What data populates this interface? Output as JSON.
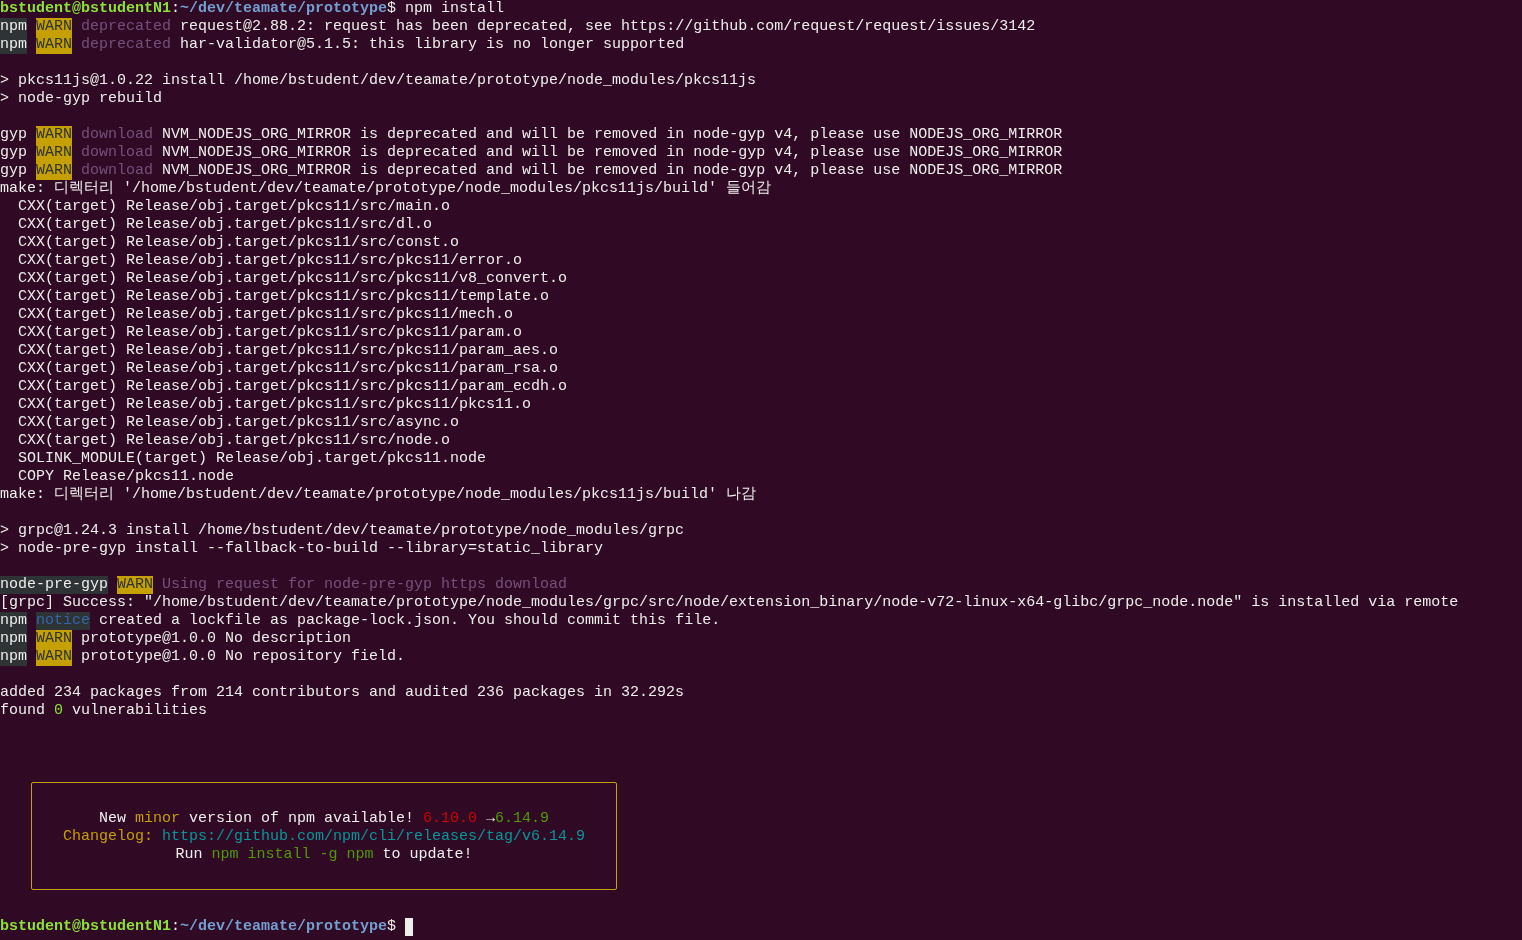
{
  "terminal": {
    "lines": [
      {
        "kind": "output",
        "segs": [
          {
            "kind": "user",
            "text": "bstudent@bstudentN1"
          },
          {
            "kind": "text",
            "text": ":"
          },
          {
            "kind": "path",
            "text": "~/dev/teamate/prototype"
          },
          {
            "kind": "text",
            "text": "$ npm install"
          }
        ]
      },
      {
        "kind": "output",
        "segs": [
          {
            "kind": "label",
            "text": "npm"
          },
          {
            "kind": "warn",
            "text": "WARN"
          },
          {
            "kind": "dim",
            "text": "deprecated"
          },
          {
            "kind": "text",
            "text": " request@2.88.2: request has been deprecated, see https://github.com/request/request/issues/3142"
          }
        ]
      },
      {
        "kind": "output",
        "segs": [
          {
            "kind": "label",
            "text": "npm"
          },
          {
            "kind": "warn",
            "text": "WARN"
          },
          {
            "kind": "dim",
            "text": "deprecated"
          },
          {
            "kind": "text",
            "text": " har-validator@5.1.5: this library is no longer supported"
          }
        ]
      },
      {
        "kind": "blank"
      },
      {
        "kind": "output",
        "segs": [
          {
            "kind": "text",
            "text": "> pkcs11js@1.0.22 install /home/bstudent/dev/teamate/prototype/node_modules/pkcs11js"
          }
        ]
      },
      {
        "kind": "output",
        "segs": [
          {
            "kind": "text",
            "text": "> node-gyp rebuild"
          }
        ]
      },
      {
        "kind": "blank"
      },
      {
        "kind": "output",
        "segs": [
          {
            "kind": "prefix",
            "text": "gyp"
          },
          {
            "kind": "warn",
            "text": "WARN"
          },
          {
            "kind": "dim",
            "text": "download"
          },
          {
            "kind": "text",
            "text": " NVM_NODEJS_ORG_MIRROR is deprecated and will be removed in node-gyp v4, please use NODEJS_ORG_MIRROR"
          }
        ]
      },
      {
        "kind": "output",
        "segs": [
          {
            "kind": "prefix",
            "text": "gyp"
          },
          {
            "kind": "warn",
            "text": "WARN"
          },
          {
            "kind": "dim",
            "text": "download"
          },
          {
            "kind": "text",
            "text": " NVM_NODEJS_ORG_MIRROR is deprecated and will be removed in node-gyp v4, please use NODEJS_ORG_MIRROR"
          }
        ]
      },
      {
        "kind": "output",
        "segs": [
          {
            "kind": "prefix",
            "text": "gyp"
          },
          {
            "kind": "warn",
            "text": "WARN"
          },
          {
            "kind": "dim",
            "text": "download"
          },
          {
            "kind": "text",
            "text": " NVM_NODEJS_ORG_MIRROR is deprecated and will be removed in node-gyp v4, please use NODEJS_ORG_MIRROR"
          }
        ]
      },
      {
        "kind": "output",
        "segs": [
          {
            "kind": "text",
            "text": "make: 디렉터리 '/home/bstudent/dev/teamate/prototype/node_modules/pkcs11js/build' 들어감"
          }
        ]
      },
      {
        "kind": "output",
        "segs": [
          {
            "kind": "text",
            "text": "  CXX(target) Release/obj.target/pkcs11/src/main.o"
          }
        ]
      },
      {
        "kind": "output",
        "segs": [
          {
            "kind": "text",
            "text": "  CXX(target) Release/obj.target/pkcs11/src/dl.o"
          }
        ]
      },
      {
        "kind": "output",
        "segs": [
          {
            "kind": "text",
            "text": "  CXX(target) Release/obj.target/pkcs11/src/const.o"
          }
        ]
      },
      {
        "kind": "output",
        "segs": [
          {
            "kind": "text",
            "text": "  CXX(target) Release/obj.target/pkcs11/src/pkcs11/error.o"
          }
        ]
      },
      {
        "kind": "output",
        "segs": [
          {
            "kind": "text",
            "text": "  CXX(target) Release/obj.target/pkcs11/src/pkcs11/v8_convert.o"
          }
        ]
      },
      {
        "kind": "output",
        "segs": [
          {
            "kind": "text",
            "text": "  CXX(target) Release/obj.target/pkcs11/src/pkcs11/template.o"
          }
        ]
      },
      {
        "kind": "output",
        "segs": [
          {
            "kind": "text",
            "text": "  CXX(target) Release/obj.target/pkcs11/src/pkcs11/mech.o"
          }
        ]
      },
      {
        "kind": "output",
        "segs": [
          {
            "kind": "text",
            "text": "  CXX(target) Release/obj.target/pkcs11/src/pkcs11/param.o"
          }
        ]
      },
      {
        "kind": "output",
        "segs": [
          {
            "kind": "text",
            "text": "  CXX(target) Release/obj.target/pkcs11/src/pkcs11/param_aes.o"
          }
        ]
      },
      {
        "kind": "output",
        "segs": [
          {
            "kind": "text",
            "text": "  CXX(target) Release/obj.target/pkcs11/src/pkcs11/param_rsa.o"
          }
        ]
      },
      {
        "kind": "output",
        "segs": [
          {
            "kind": "text",
            "text": "  CXX(target) Release/obj.target/pkcs11/src/pkcs11/param_ecdh.o"
          }
        ]
      },
      {
        "kind": "output",
        "segs": [
          {
            "kind": "text",
            "text": "  CXX(target) Release/obj.target/pkcs11/src/pkcs11/pkcs11.o"
          }
        ]
      },
      {
        "kind": "output",
        "segs": [
          {
            "kind": "text",
            "text": "  CXX(target) Release/obj.target/pkcs11/src/async.o"
          }
        ]
      },
      {
        "kind": "output",
        "segs": [
          {
            "kind": "text",
            "text": "  CXX(target) Release/obj.target/pkcs11/src/node.o"
          }
        ]
      },
      {
        "kind": "output",
        "segs": [
          {
            "kind": "text",
            "text": "  SOLINK_MODULE(target) Release/obj.target/pkcs11.node"
          }
        ]
      },
      {
        "kind": "output",
        "segs": [
          {
            "kind": "text",
            "text": "  COPY Release/pkcs11.node"
          }
        ]
      },
      {
        "kind": "output",
        "segs": [
          {
            "kind": "text",
            "text": "make: 디렉터리 '/home/bstudent/dev/teamate/prototype/node_modules/pkcs11js/build' 나감"
          }
        ]
      },
      {
        "kind": "blank"
      },
      {
        "kind": "output",
        "segs": [
          {
            "kind": "text",
            "text": "> grpc@1.24.3 install /home/bstudent/dev/teamate/prototype/node_modules/grpc"
          }
        ]
      },
      {
        "kind": "output",
        "segs": [
          {
            "kind": "text",
            "text": "> node-pre-gyp install --fallback-to-build --library=static_library"
          }
        ]
      },
      {
        "kind": "blank"
      },
      {
        "kind": "output",
        "segs": [
          {
            "kind": "label",
            "text": "node-pre-gyp"
          },
          {
            "kind": "warn",
            "text": "WARN"
          },
          {
            "kind": "dim",
            "text": "Using request for node-pre-gyp https download"
          }
        ]
      },
      {
        "kind": "output",
        "segs": [
          {
            "kind": "text",
            "text": "[grpc] Success: \"/home/bstudent/dev/teamate/prototype/node_modules/grpc/src/node/extension_binary/node-v72-linux-x64-glibc/grpc_node.node\" is installed via remote"
          }
        ]
      },
      {
        "kind": "output",
        "segs": [
          {
            "kind": "label",
            "text": "npm"
          },
          {
            "kind": "notice",
            "text": "notice"
          },
          {
            "kind": "text",
            "text": " created a lockfile as package-lock.json. You should commit this file."
          }
        ]
      },
      {
        "kind": "output",
        "segs": [
          {
            "kind": "label",
            "text": "npm"
          },
          {
            "kind": "warn",
            "text": "WARN"
          },
          {
            "kind": "text",
            "text": "prototype@1.0.0 No description"
          }
        ]
      },
      {
        "kind": "output",
        "segs": [
          {
            "kind": "label",
            "text": "npm"
          },
          {
            "kind": "warn",
            "text": "WARN"
          },
          {
            "kind": "text",
            "text": "prototype@1.0.0 No repository field."
          }
        ]
      },
      {
        "kind": "blank"
      },
      {
        "kind": "output",
        "segs": [
          {
            "kind": "text",
            "text": "added 234 packages from 214 contributors and audited 236 packages in 32.292s"
          }
        ]
      },
      {
        "kind": "output",
        "segs": [
          {
            "kind": "text",
            "text": "found "
          },
          {
            "kind": "lime",
            "text": "0"
          },
          {
            "kind": "text",
            "text": " vulnerabilities"
          }
        ]
      }
    ],
    "update_box": {
      "lines": [
        {
          "kind": "output",
          "segs": [
            {
              "kind": "text",
              "text": "New "
            },
            {
              "kind": "yellow",
              "text": "minor"
            },
            {
              "kind": "text",
              "text": " version of npm available! "
            },
            {
              "kind": "red",
              "text": "6.10.0"
            },
            {
              "kind": "text",
              "text": " →"
            },
            {
              "kind": "green",
              "text": "6.14.9"
            }
          ]
        },
        {
          "kind": "output",
          "segs": [
            {
              "kind": "yellow",
              "text": "Changelog:"
            },
            {
              "kind": "cyan",
              "text": " https://github.com/npm/cli/releases/tag/v6.14.9"
            }
          ]
        },
        {
          "kind": "output",
          "segs": [
            {
              "kind": "text",
              "text": "Run "
            },
            {
              "kind": "green",
              "text": "npm install -g npm"
            },
            {
              "kind": "text",
              "text": " to update!"
            }
          ]
        }
      ]
    },
    "prompt": {
      "segs": [
        {
          "kind": "user",
          "text": "bstudent@bstudentN1"
        },
        {
          "kind": "text",
          "text": ":"
        },
        {
          "kind": "path",
          "text": "~/dev/teamate/prototype"
        },
        {
          "kind": "text",
          "text": "$"
        }
      ],
      "cursor": true
    }
  }
}
